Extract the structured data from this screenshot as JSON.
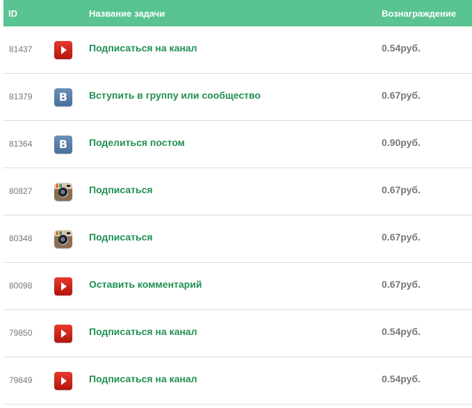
{
  "header": {
    "id": "ID",
    "name": "Название задачи",
    "reward": "Вознаграждение"
  },
  "colors": {
    "header_bg": "#59c391",
    "task_link": "#1f8f52",
    "muted_text": "#777777"
  },
  "tasks": [
    {
      "id": "81437",
      "icon": "youtube-icon",
      "name": "Подписаться на канал",
      "reward": "0.54руб."
    },
    {
      "id": "81379",
      "icon": "vk-icon",
      "name": "Вступить в группу или сообщество",
      "reward": "0.67руб."
    },
    {
      "id": "81364",
      "icon": "vk-icon",
      "name": "Поделиться постом",
      "reward": "0.90руб."
    },
    {
      "id": "80827",
      "icon": "instagram-icon",
      "name": "Подписаться",
      "reward": "0.67руб."
    },
    {
      "id": "80348",
      "icon": "instagram-icon",
      "name": "Подписаться",
      "reward": "0.67руб."
    },
    {
      "id": "80098",
      "icon": "youtube-icon",
      "name": "Оставить комментарий",
      "reward": "0.67руб."
    },
    {
      "id": "79850",
      "icon": "youtube-icon",
      "name": "Подписаться на канал",
      "reward": "0.54руб."
    },
    {
      "id": "79849",
      "icon": "youtube-icon",
      "name": "Подписаться на канал",
      "reward": "0.54руб."
    }
  ]
}
